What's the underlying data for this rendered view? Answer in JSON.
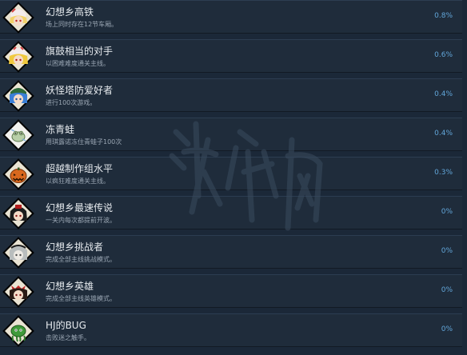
{
  "achievements": [
    {
      "title": "幻想乡高铁",
      "desc": "场上同时存在12节车厢。",
      "percent": "0.8%",
      "icon": "flandre-icon",
      "accent": "#d64545"
    },
    {
      "title": "旗鼓相当的对手",
      "desc": "以困难难度通关主线。",
      "percent": "0.6%",
      "icon": "flandre-icon",
      "accent": "#e0b030"
    },
    {
      "title": "妖怪塔防爱好者",
      "desc": "进行100次游戏。",
      "percent": "0.4%",
      "icon": "nitori-icon",
      "accent": "#3b7fd6"
    },
    {
      "title": "冻青蛙",
      "desc": "用琪露诺冻住青蛙子100次",
      "percent": "0.4%",
      "icon": "frog-icon",
      "accent": "#8fb27a"
    },
    {
      "title": "超越制作组水平",
      "desc": "以疯狂难度通关主线。",
      "percent": "0.3%",
      "icon": "pumpkin-icon",
      "accent": "#d9681e"
    },
    {
      "title": "幻想乡最速传说",
      "desc": "一关内每次都提前开波。",
      "percent": "0%",
      "icon": "aya-icon",
      "accent": "#7a1f1f"
    },
    {
      "title": "幻想乡挑战者",
      "desc": "完成全部主线挑战模式。",
      "percent": "0%",
      "icon": "youmu-icon",
      "accent": "#9aa0a0"
    },
    {
      "title": "幻想乡英雄",
      "desc": "完成全部主线英雄模式。",
      "percent": "0%",
      "icon": "reimu-icon",
      "accent": "#c02828"
    },
    {
      "title": "HJ的BUG",
      "desc": "击败迷之触手。",
      "percent": "0%",
      "icon": "tentacle-icon",
      "accent": "#3f9a3a"
    }
  ],
  "colors": {
    "background": "#1b2838",
    "row": "#1f2c3b",
    "title": "#e6eaee",
    "desc": "#9aa6b3",
    "percent": "#62a6d9",
    "icon_frame": "#e9e3d2"
  }
}
